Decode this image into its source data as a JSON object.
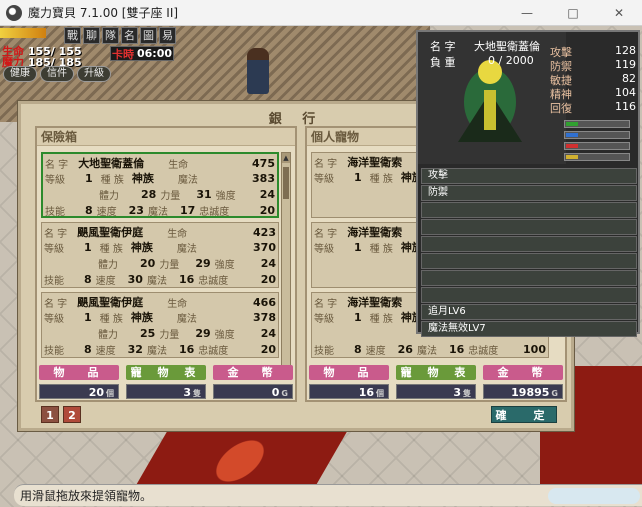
{
  "window": {
    "title": "魔力寶貝 7.1.00 [雙子座 II]",
    "minimize": "—",
    "maximize": "□",
    "close": "✕"
  },
  "status": {
    "hp_label": "生命",
    "hp_value": "155/ 155",
    "mp_label": "魔力",
    "mp_value": "185/ 185",
    "clock_label": "卡時",
    "clock_value": "06:00",
    "quick_icons": [
      "戰",
      "聊",
      "隊",
      "名",
      "圖",
      "易"
    ],
    "buttons": [
      "健康",
      "信件",
      "升級"
    ]
  },
  "bank": {
    "title": "銀 行",
    "safe_box": {
      "header": "保險箱",
      "pets": [
        {
          "name_label": "名 字",
          "name": "大地聖衛蓋倫",
          "hp_label": "生命",
          "hp": "475",
          "level_label": "等級",
          "level": "1",
          "race_label": "種 族",
          "race": "神族",
          "mp_label": "魔法",
          "mp": "383",
          "vit_label": "體力",
          "vit": "28",
          "str_label": "力量",
          "str": "31",
          "tgh_label": "強度",
          "tgh": "24",
          "skill_label": "技能",
          "skill": "8",
          "spd_label": "速度",
          "spd": "23",
          "mag_label": "魔法",
          "mag": "17",
          "loyal_label": "忠誠度",
          "loyal": "20"
        },
        {
          "name_label": "名 字",
          "name": "颶風聖衛伊庭",
          "hp_label": "生命",
          "hp": "423",
          "level_label": "等級",
          "level": "1",
          "race_label": "種 族",
          "race": "神族",
          "mp_label": "魔法",
          "mp": "370",
          "vit_label": "體力",
          "vit": "20",
          "str_label": "力量",
          "str": "29",
          "tgh_label": "強度",
          "tgh": "24",
          "skill_label": "技能",
          "skill": "8",
          "spd_label": "速度",
          "spd": "30",
          "mag_label": "魔法",
          "mag": "16",
          "loyal_label": "忠誠度",
          "loyal": "20"
        },
        {
          "name_label": "名 字",
          "name": "颶風聖衛伊庭",
          "hp_label": "生命",
          "hp": "466",
          "level_label": "等級",
          "level": "1",
          "race_label": "種 族",
          "race": "神族",
          "mp_label": "魔法",
          "mp": "378",
          "vit_label": "體力",
          "vit": "25",
          "str_label": "力量",
          "str": "29",
          "tgh_label": "強度",
          "tgh": "24",
          "skill_label": "技能",
          "skill": "8",
          "spd_label": "速度",
          "spd": "32",
          "mag_label": "魔法",
          "mag": "16",
          "loyal_label": "忠誠度",
          "loyal": "20"
        }
      ],
      "tabs": [
        "物　品",
        "寵 物 表",
        "金　幣"
      ],
      "values": [
        {
          "value": "20",
          "unit": "個"
        },
        {
          "value": "3",
          "unit": "隻"
        },
        {
          "value": "0",
          "unit": "G"
        }
      ]
    },
    "personal": {
      "header": "個人寵物",
      "pets": [
        {
          "name_label": "名 字",
          "name": "海洋聖衛索",
          "level_label": "等級",
          "level": "1",
          "race_label": "種 族",
          "race": "神族"
        },
        {
          "name_label": "名 字",
          "name": "海洋聖衛索",
          "level_label": "等級",
          "level": "1",
          "race_label": "種 族",
          "race": "神族"
        },
        {
          "name_label": "名 字",
          "name": "海洋聖衛索",
          "level_label": "等級",
          "level": "1",
          "race_label": "種 族",
          "race": "神族",
          "skill_label": "技能",
          "skill": "8",
          "spd_label": "速度",
          "spd": "26",
          "mag_label": "魔法",
          "mag": "16",
          "loyal_label": "忠誠度",
          "loyal": "100"
        }
      ],
      "tabs": [
        "物　品",
        "寵 物 表",
        "金　幣"
      ],
      "values": [
        {
          "value": "16",
          "unit": "個"
        },
        {
          "value": "3",
          "unit": "隻"
        },
        {
          "value": "19895",
          "unit": "G"
        }
      ]
    },
    "pages": [
      "1",
      "2"
    ],
    "confirm": "確　定"
  },
  "detail": {
    "name_label": "名 字",
    "name": "大地聖衛蓋倫",
    "weight_label": "負 重",
    "weight": "0 / 2000",
    "stats": [
      {
        "name": "攻擊",
        "value": "128"
      },
      {
        "name": "防禦",
        "value": "119"
      },
      {
        "name": "敏捷",
        "value": "82"
      },
      {
        "name": "精神",
        "value": "104"
      },
      {
        "name": "回復",
        "value": "116"
      }
    ],
    "skills": [
      "攻擊",
      "防禦",
      "",
      "",
      "",
      "",
      "",
      "",
      "追月LV6",
      "魔法無效LV7"
    ]
  },
  "message": "用滑鼠拖放來提領寵物。",
  "colors": {
    "selected_border": "#2c8a2c",
    "tab_pink": "#c95b8c",
    "tab_green": "#6a9a3a"
  }
}
